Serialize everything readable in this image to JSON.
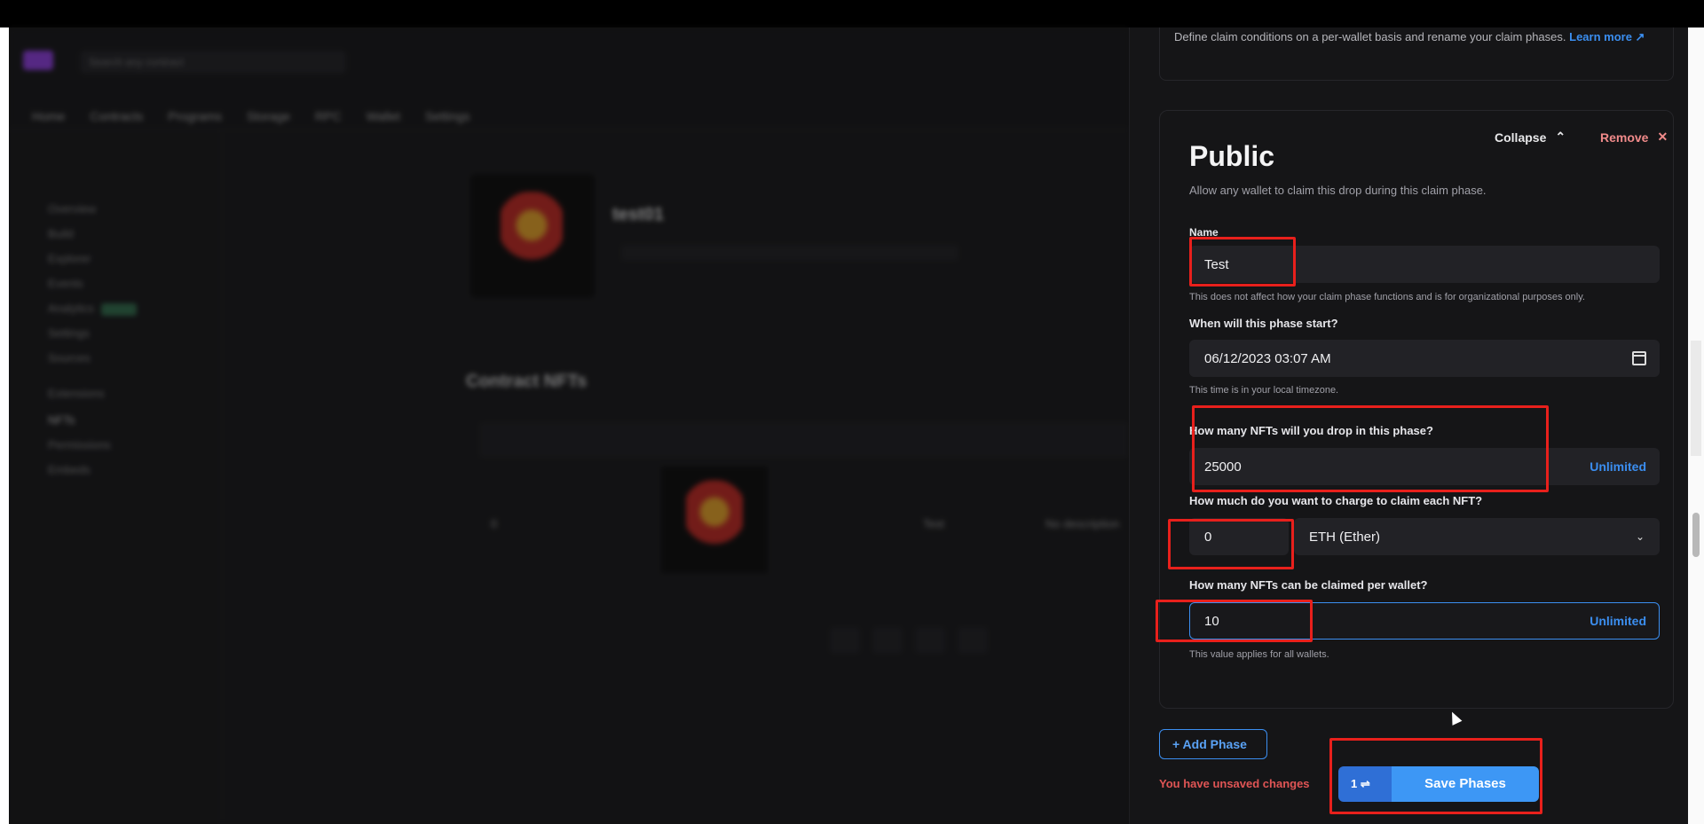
{
  "drawer": {
    "intro": "Define claim conditions on a per-wallet basis and rename your claim phases.",
    "learn_more": "Learn more ↗",
    "phase": {
      "title": "Public",
      "description": "Allow any wallet to claim this drop during this claim phase.",
      "collapse_label": "Collapse",
      "remove_label": "Remove",
      "name": {
        "label": "Name",
        "value": "Test",
        "hint": "This does not affect how your claim phase functions and is for organizational purposes only."
      },
      "start": {
        "label": "When will this phase start?",
        "value": "06/12/2023 03:07 AM",
        "hint": "This time is in your local timezone."
      },
      "supply": {
        "label": "How many NFTs will you drop in this phase?",
        "value": "25000",
        "unlimited": "Unlimited"
      },
      "price": {
        "label": "How much do you want to charge to claim each NFT?",
        "value": "0",
        "currency": "ETH (Ether)"
      },
      "per_wallet": {
        "label": "How many NFTs can be claimed per wallet?",
        "value": "10",
        "unlimited": "Unlimited",
        "hint": "This value applies for all wallets."
      }
    },
    "add_phase": "+ Add Phase",
    "unsaved": "You have unsaved changes",
    "save_count": "1 ⇌",
    "save_label": "Save Phases"
  },
  "background": {
    "search_placeholder": "Search any contract",
    "nav": [
      "Home",
      "Contracts",
      "Programs",
      "Storage",
      "RPC",
      "Wallet",
      "Settings"
    ],
    "sidebar": [
      "Overview",
      "Build",
      "Explorer",
      "Events",
      "Analytics",
      "Settings",
      "Sources",
      "Extensions",
      "NFTs",
      "Permissions",
      "Embeds"
    ],
    "contract_title": "test01",
    "section_title": "Contract NFTs",
    "row": {
      "id": "0",
      "name": "Test",
      "description": "No description"
    }
  },
  "colors": {
    "accent": "#3b8ef0",
    "danger": "#e05555",
    "highlight": "#e8201c"
  }
}
